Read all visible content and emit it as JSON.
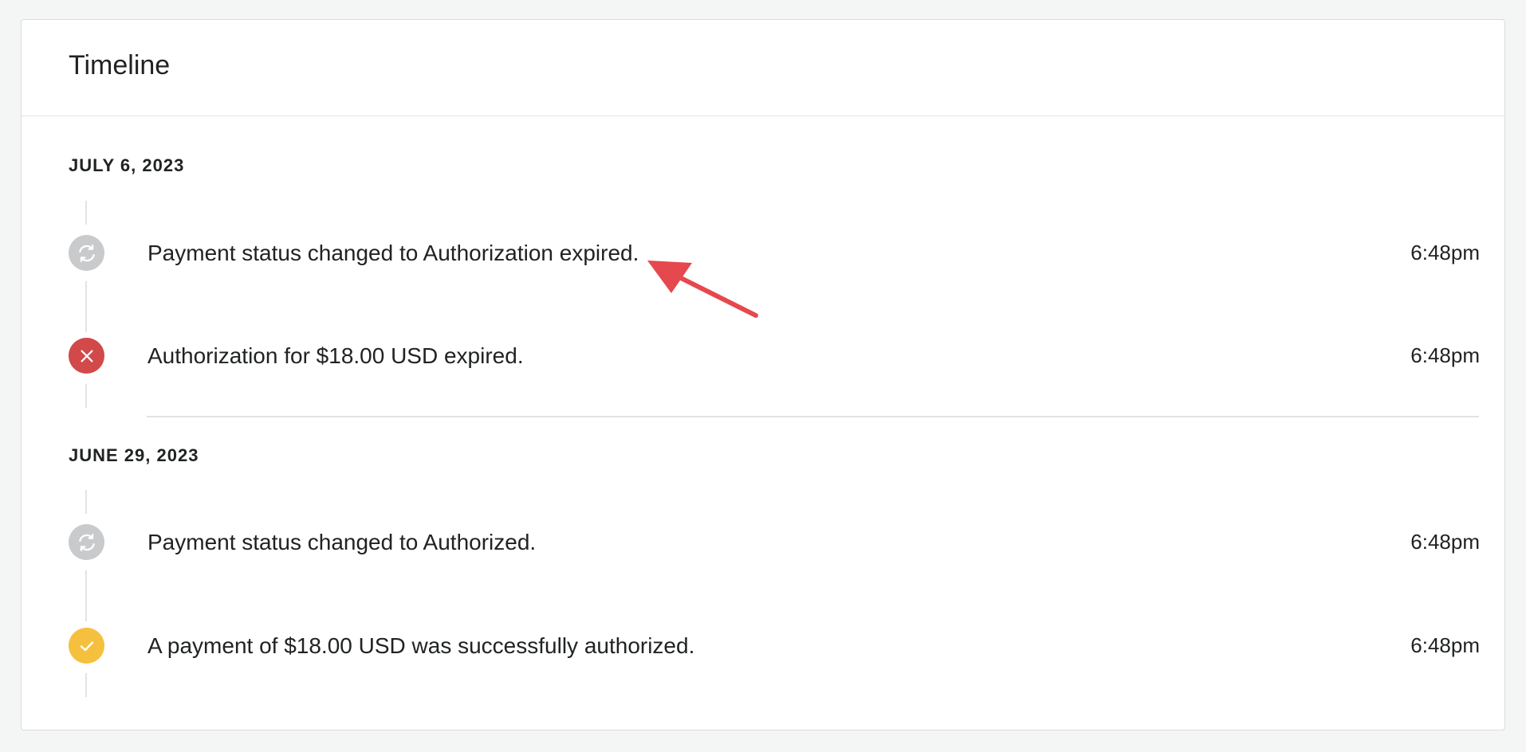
{
  "card": {
    "title": "Timeline"
  },
  "groups": [
    {
      "date": "JULY 6, 2023",
      "events": [
        {
          "text": "Payment status changed to Authorization expired.",
          "time": "6:48pm",
          "icon": "refresh-icon",
          "icon_color": "#c9cacc"
        },
        {
          "text": "Authorization for $18.00 USD expired.",
          "time": "6:48pm",
          "icon": "close-icon",
          "icon_color": "#d14949"
        }
      ]
    },
    {
      "date": "JUNE 29, 2023",
      "events": [
        {
          "text": "Payment status changed to Authorized.",
          "time": "6:48pm",
          "icon": "refresh-icon",
          "icon_color": "#c9cacc"
        },
        {
          "text": "A payment of $18.00 USD was successfully authorized.",
          "time": "6:48pm",
          "icon": "checkmark-icon",
          "icon_color": "#f5c03d"
        }
      ]
    }
  ],
  "annotation": {
    "color": "#e5484d",
    "icon": "red-arrow-icon"
  }
}
